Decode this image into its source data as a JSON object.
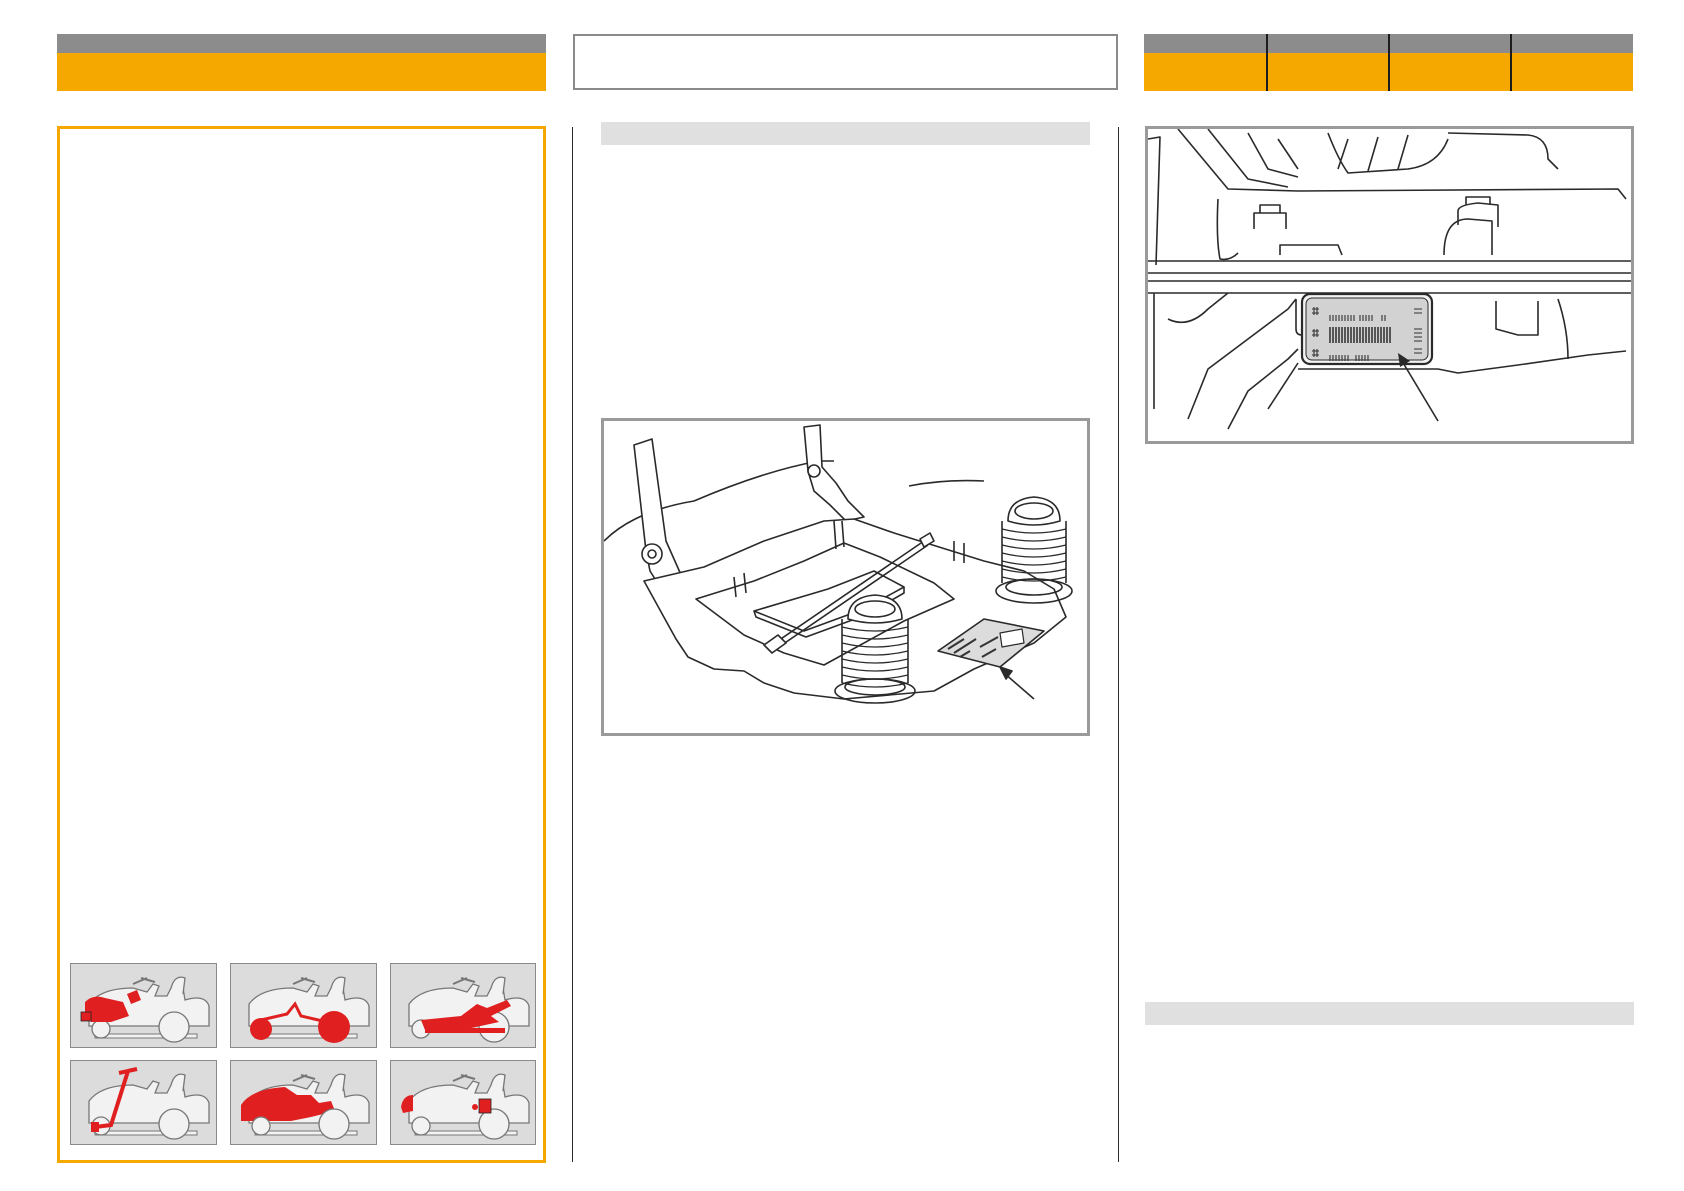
{
  "page": {
    "left_header": {
      "title": ""
    },
    "center_header": {
      "title": ""
    },
    "right_header": {
      "tabs": [
        "",
        "",
        "",
        ""
      ]
    },
    "center_section_title": "",
    "right_section_title": "",
    "colors": {
      "accent": "#f5a800",
      "header_gray": "#8c8c8c",
      "section_bar": "#e0e0e0",
      "highlight_red": "#e02020"
    }
  },
  "left_panel": {
    "thumbnails": [
      {
        "name": "engine-highlight",
        "icon": "tractor-engine-icon"
      },
      {
        "name": "wheels-highlight",
        "icon": "tractor-wheels-icon"
      },
      {
        "name": "chassis-highlight",
        "icon": "tractor-chassis-icon"
      },
      {
        "name": "steering-highlight",
        "icon": "tractor-steering-icon"
      },
      {
        "name": "body-highlight",
        "icon": "tractor-body-icon"
      },
      {
        "name": "electrical-highlight",
        "icon": "tractor-electrical-icon"
      }
    ]
  },
  "figures": {
    "center": {
      "icon": "seat-plate-location-icon"
    },
    "right": {
      "icon": "frame-label-location-icon"
    }
  }
}
